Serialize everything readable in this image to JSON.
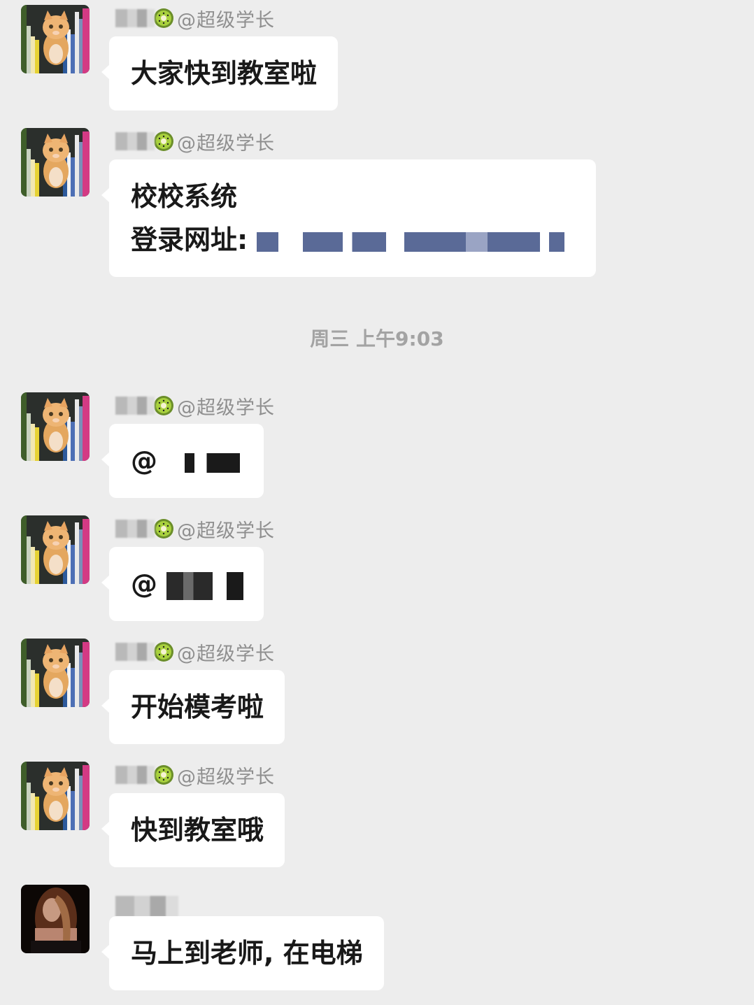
{
  "chat": {
    "time_separator": "周三 上午9:03",
    "sender_tag": "@超级学长",
    "messages": [
      {
        "avatar": "cat-avatar",
        "sender_tag": "@超级学长",
        "lines": [
          "大家快到教室啦"
        ]
      },
      {
        "avatar": "cat-avatar",
        "sender_tag": "@超级学长",
        "lines": [
          "校校系统",
          "登录网址:"
        ]
      },
      {
        "avatar": "cat-avatar",
        "sender_tag": "@超级学长",
        "lines": [
          "@"
        ]
      },
      {
        "avatar": "cat-avatar",
        "sender_tag": "@超级学长",
        "lines": [
          "@"
        ]
      },
      {
        "avatar": "cat-avatar",
        "sender_tag": "@超级学长",
        "lines": [
          "开始模考啦"
        ]
      },
      {
        "avatar": "cat-avatar",
        "sender_tag": "@超级学长",
        "lines": [
          "快到教室哦"
        ]
      },
      {
        "avatar": "woman-avatar",
        "sender_tag": "",
        "lines": [
          "马上到老师, 在电梯"
        ]
      }
    ]
  },
  "icons": {
    "kiwi": "kiwi-emoji-icon",
    "cat_avatar": "cat-avatar",
    "woman_avatar": "woman-avatar"
  },
  "colors": {
    "background": "#ededed",
    "bubble": "#ffffff",
    "text": "#191919",
    "meta": "#8f8f8f",
    "redacted_link": "#5a6a97"
  }
}
